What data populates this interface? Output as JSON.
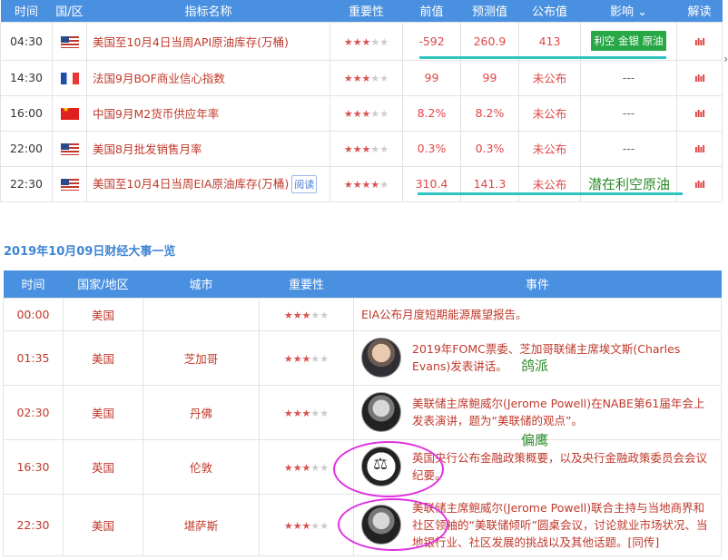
{
  "top_table": {
    "headers": [
      "时间",
      "国/区",
      "指标名称",
      "重要性",
      "前值",
      "预测值",
      "公布值",
      "影响",
      "解读"
    ],
    "impact_chevron": "chevron-down-icon",
    "rows": [
      {
        "time": "04:30",
        "flag": "us",
        "name": "美国至10月4日当周API原油库存(万桶)",
        "stars": 3,
        "prev": "-592",
        "forecast": "260.9",
        "actual": "413",
        "impact": "利空 金银 原油",
        "read_btn": ""
      },
      {
        "time": "14:30",
        "flag": "fr",
        "name": "法国9月BOF商业信心指数",
        "stars": 3,
        "prev": "99",
        "forecast": "99",
        "actual": "未公布",
        "impact": "---",
        "read_btn": ""
      },
      {
        "time": "16:00",
        "flag": "cn",
        "name": "中国9月M2货币供应年率",
        "stars": 3,
        "prev": "8.2%",
        "forecast": "8.2%",
        "actual": "未公布",
        "impact": "---",
        "read_btn": ""
      },
      {
        "time": "22:00",
        "flag": "us",
        "name": "美国8月批发销售月率",
        "stars": 3,
        "prev": "0.3%",
        "forecast": "0.3%",
        "actual": "未公布",
        "impact": "---",
        "read_btn": ""
      },
      {
        "time": "22:30",
        "flag": "us",
        "name": "美国至10月4日当周EIA原油库存(万桶)",
        "stars": 4,
        "prev": "310.4",
        "forecast": "141.3",
        "actual": "未公布",
        "impact": "",
        "read_btn": "阅读"
      }
    ]
  },
  "annotations": {
    "eia_note": "潜在利空原油",
    "dovish_note": "鸽派",
    "hawk_dove_note": "偏鹰"
  },
  "section_title": "2019年10月09日财经大事一览",
  "events_table": {
    "headers": [
      "时间",
      "国家/地区",
      "城市",
      "重要性",
      "事件"
    ],
    "rows": [
      {
        "time": "00:00",
        "country": "美国",
        "city": "",
        "stars": 3,
        "avatar": "",
        "event": "EIA公布月度短期能源展望报告。"
      },
      {
        "time": "01:35",
        "country": "美国",
        "city": "芝加哥",
        "stars": 3,
        "avatar": "person",
        "event": "2019年FOMC票委、芝加哥联储主席埃文斯(Charles Evans)发表讲话。"
      },
      {
        "time": "02:30",
        "country": "美国",
        "city": "丹佛",
        "stars": 3,
        "avatar": "person",
        "event": "美联储主席鲍威尔(Jerome Powell)在NABE第61届年会上发表演讲，题为“美联储的观点”。"
      },
      {
        "time": "16:30",
        "country": "英国",
        "city": "伦敦",
        "stars": 3,
        "avatar": "boe",
        "event": "英国央行公布金融政策概要，以及央行金融政策委员会会议纪要。"
      },
      {
        "time": "22:30",
        "country": "美国",
        "city": "堪萨斯",
        "stars": 3,
        "avatar": "person",
        "event": "美联储主席鲍威尔(Jerome Powell)联合主持与当地商界和社区领袖的“美联储倾听”圆桌会议，讨论就业市场状况、当地银行业、社区发展的挑战以及其他话题。[同传]"
      }
    ]
  },
  "colors": {
    "header_bg": "#4a90e0",
    "accent_red": "#e04646",
    "impact_green": "#27a745",
    "highlight": "#2ec5c0",
    "circle": "#e030e0"
  }
}
